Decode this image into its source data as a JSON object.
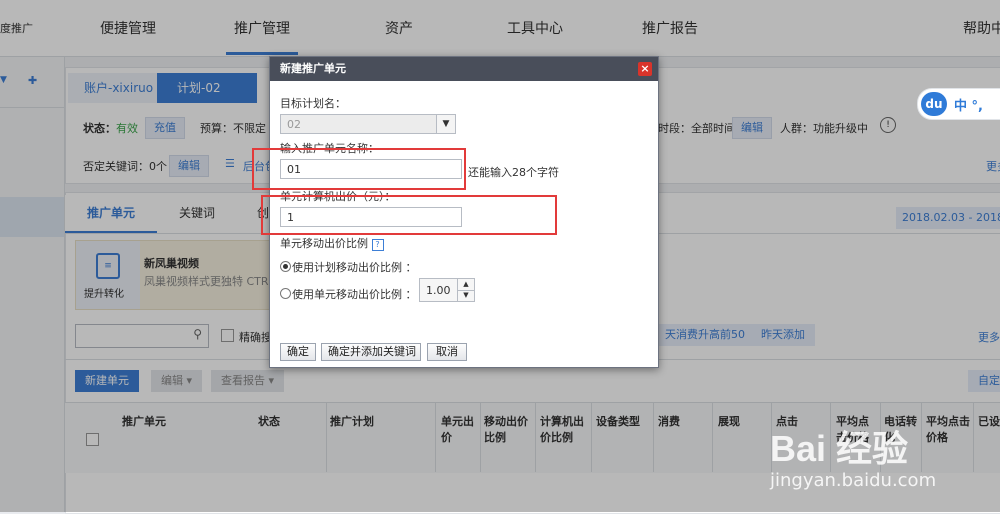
{
  "topnav": {
    "left_label": "度推广",
    "items": [
      "便捷管理",
      "推广管理",
      "资产",
      "工具中心",
      "推广报告",
      "帮助中"
    ]
  },
  "breadcrumb": {
    "account": "账户-xixiruo",
    "plan": "计划-02"
  },
  "info_row1": {
    "status_label": "状态：",
    "status_value": "有效",
    "recharge": "充值",
    "budget_label": "预算：不限定",
    "time_label": "时段：全部时间",
    "time_edit": "编辑",
    "crowd_label": "人群：功能升级中"
  },
  "info_row2": {
    "neg_kw": "否定关键词：0个",
    "edit": "编辑",
    "bg_label": "后台包",
    "more": "更多"
  },
  "tabs": [
    "推广单元",
    "关键词",
    "创"
  ],
  "date_range": "2018.02.03 - 2018.0",
  "promo_card": {
    "icon_label": "提升转化",
    "title": "新凤巢视频",
    "desc": "凤巢视频样式更独特 CTR比"
  },
  "filter_row": {
    "checkbox_label": "精确搜",
    "btn_top50": "天消费升高前50",
    "btn_yesterday": "昨天添加",
    "more": "更多"
  },
  "toolbar": {
    "new_unit": "新建单元",
    "edit": "编辑",
    "view_report": "查看报告",
    "custom": "自定"
  },
  "table_headers": [
    "推广单元",
    "状态",
    "推广计划",
    "单元出价",
    "移动出价比例",
    "计算机出价比例",
    "设备类型",
    "消费",
    "展现",
    "点击",
    "平均点击价格",
    "电话转化",
    "平均点击价格",
    "已设"
  ],
  "dialog": {
    "title": "新建推广单元",
    "close": "×",
    "plan_label": "目标计划名：",
    "plan_value": "02",
    "name_label": "输入推广单元名称：",
    "name_value": "01",
    "name_hint": "还能输入28个字符",
    "bid_label": "单元计算机出价（元）：",
    "bid_value": "1",
    "mobile_label": "单元移动出价比例",
    "help": "?",
    "radio1": "使用计划移动出价比例 ：",
    "radio2": "使用单元移动出价比例 ：",
    "ratio_value": "1.00",
    "btn_ok": "确定",
    "btn_ok_add": "确定并添加关键词",
    "btn_cancel": "取消"
  },
  "du_widget": {
    "logo": "du",
    "text": "中 °,"
  },
  "watermark": {
    "brand": "Bai 经验",
    "url": "jingyan.baidu.com"
  }
}
